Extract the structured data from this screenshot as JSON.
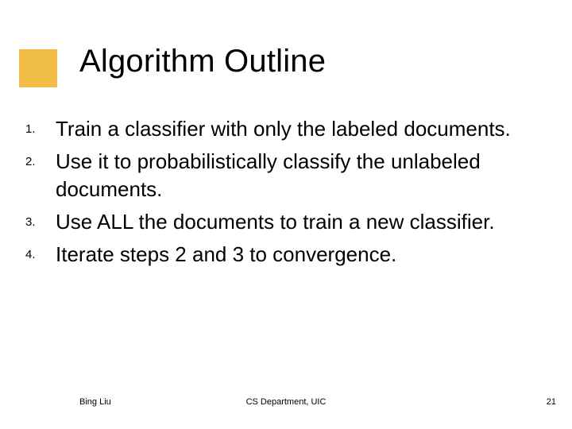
{
  "title": "Algorithm Outline",
  "items": {
    "0": {
      "n": "1.",
      "t": "Train a classifier with only the labeled documents."
    },
    "1": {
      "n": "2.",
      "t": "Use it to probabilistically classify the unlabeled documents."
    },
    "2": {
      "n": "3.",
      "t": "Use ALL the documents to train a new classifier."
    },
    "3": {
      "n": "4.",
      "t": "Iterate steps 2 and 3 to convergence."
    }
  },
  "footer": {
    "left": "Bing Liu",
    "center": "CS Department, UIC",
    "right": "21"
  }
}
